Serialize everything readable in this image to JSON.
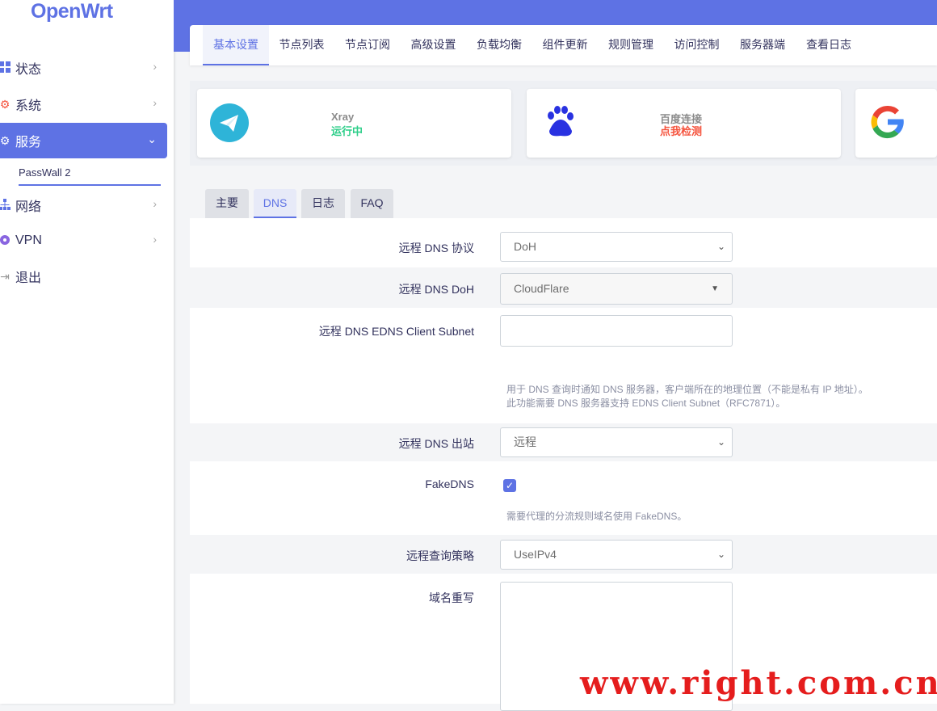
{
  "brand": {
    "name": "OpenWrt",
    "color": "#5e72e4"
  },
  "sidebar": {
    "items": [
      {
        "label": "状态",
        "icon": "dashboard-icon"
      },
      {
        "label": "系统",
        "icon": "gear-icon"
      },
      {
        "label": "服务",
        "icon": "services-icon",
        "active": true
      },
      {
        "label": "网络",
        "icon": "network-icon"
      },
      {
        "label": "VPN",
        "icon": "vpn-icon"
      },
      {
        "label": "退出",
        "icon": "logout-icon"
      }
    ],
    "subitem": "PassWall 2"
  },
  "main_tabs": [
    "基本设置",
    "节点列表",
    "节点订阅",
    "高级设置",
    "负载均衡",
    "组件更新",
    "规则管理",
    "访问控制",
    "服务器端",
    "查看日志"
  ],
  "status_cards": [
    {
      "title": "Xray",
      "status": "运行中",
      "status_color": "#2dce89",
      "icon": "telegram-icon"
    },
    {
      "title": "百度连接",
      "status": "点我检测",
      "status_color": "#f5533d",
      "icon": "baidu-paw-icon"
    },
    {
      "title": "",
      "status": "",
      "icon": "google-icon"
    }
  ],
  "content_tabs": [
    "主要",
    "DNS",
    "日志",
    "FAQ"
  ],
  "form": {
    "dns_protocol": {
      "label": "远程 DNS 协议",
      "value": "DoH"
    },
    "dns_doh": {
      "label": "远程 DNS DoH",
      "value": "CloudFlare"
    },
    "edns": {
      "label": "远程 DNS EDNS Client Subnet",
      "value": "",
      "help_line1": "用于 DNS 查询时通知 DNS 服务器，客户端所在的地理位置（不能是私有 IP 地址）。",
      "help_line2": "此功能需要 DNS 服务器支持 EDNS Client Subnet（RFC7871）。"
    },
    "dns_outbound": {
      "label": "远程 DNS 出站",
      "value": "远程"
    },
    "fakedns": {
      "label": "FakeDNS",
      "checked": true,
      "help": "需要代理的分流规则域名使用 FakeDNS。"
    },
    "query_strategy": {
      "label": "远程查询策略",
      "value": "UseIPv4"
    },
    "domain_rewrite": {
      "label": "域名重写",
      "value": ""
    }
  },
  "watermark": "www.right.com.cn"
}
